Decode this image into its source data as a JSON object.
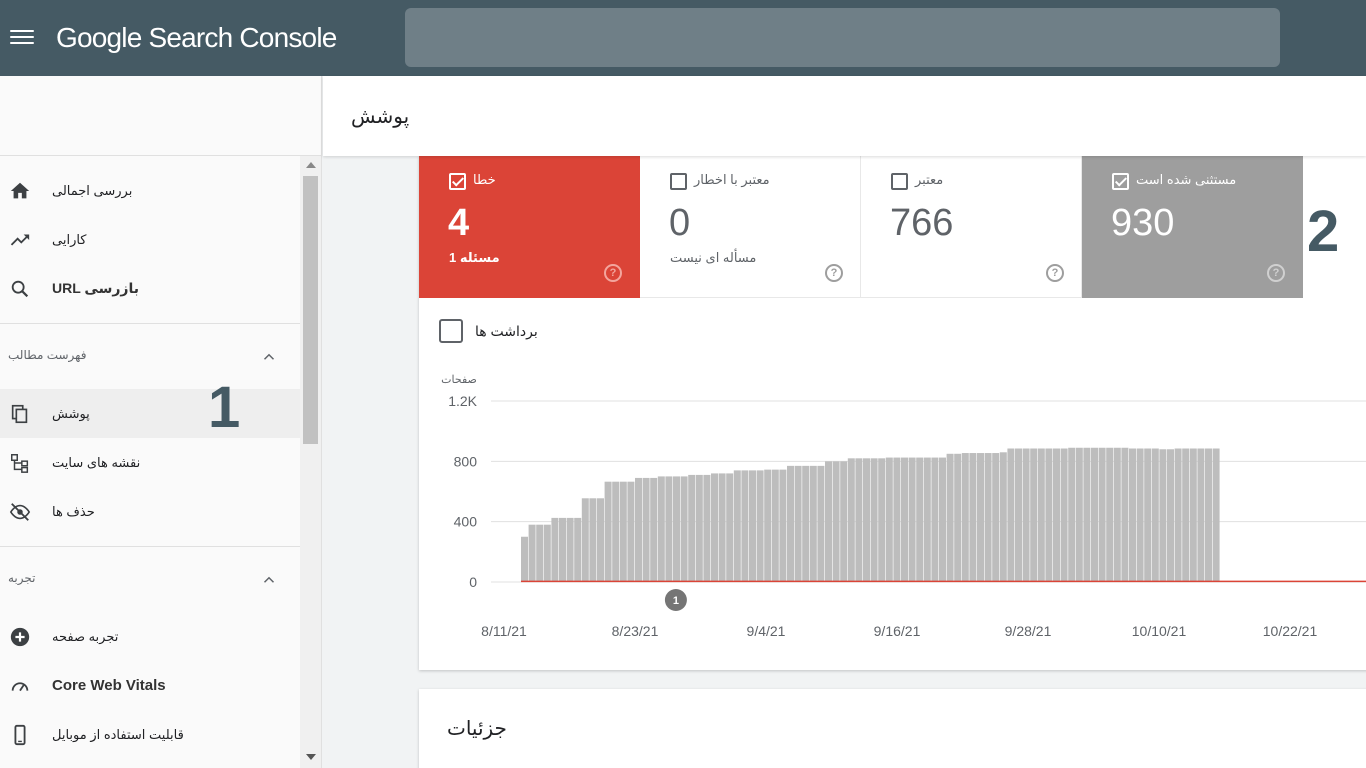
{
  "app": {
    "brand_google": "Google",
    "brand_product": "Search Console"
  },
  "page": {
    "title": "پوشش"
  },
  "sidebar": {
    "items_top": [
      {
        "label": "بررسی اجمالی",
        "icon": "home-icon"
      },
      {
        "label": "کارایی",
        "icon": "trending-up-icon"
      },
      {
        "label": "URL بازرسی",
        "icon": "search-icon"
      }
    ],
    "section_index": {
      "title": "فهرست مطالب"
    },
    "items_index": [
      {
        "label": "پوشش",
        "icon": "copy-pages-icon",
        "active": true
      },
      {
        "label": "نقشه های سایت",
        "icon": "sitemap-icon"
      },
      {
        "label": "حذف ها",
        "icon": "eye-off-icon"
      }
    ],
    "section_experience": {
      "title": "تجربه"
    },
    "items_experience": [
      {
        "label": "تجربه صفحه",
        "icon": "plus-circle-icon"
      },
      {
        "label": "Core Web Vitals",
        "icon": "speed-gauge-icon"
      },
      {
        "label": "قابلیت استفاده از موبایل",
        "icon": "smartphone-icon"
      }
    ]
  },
  "annotations": {
    "one": "1",
    "two": "2"
  },
  "tiles": [
    {
      "key": "error",
      "label": "خطا",
      "value": "4",
      "sub": "1 مسئله",
      "checked": true
    },
    {
      "key": "warning",
      "label": "معتبر با اخطار",
      "value": "0",
      "sub": "مسأله ای نیست",
      "checked": false
    },
    {
      "key": "valid",
      "label": "معتبر",
      "value": "766",
      "sub": "",
      "checked": false
    },
    {
      "key": "excluded",
      "label": "مستثنی شده است",
      "value": "930",
      "sub": "",
      "checked": true
    }
  ],
  "impressions_label": "برداشت ها",
  "colors": {
    "error": "#db4437",
    "excluded": "#9e9e9e",
    "topbar": "#455a64",
    "bar": "#bdbdbd"
  },
  "chart_data": {
    "type": "bar",
    "ylabel": "صفحات",
    "yticks": [
      "0",
      "400",
      "800",
      "1.2K"
    ],
    "ylim": [
      0,
      1200
    ],
    "xticks": [
      "8/11/21",
      "8/23/21",
      "9/4/21",
      "9/16/21",
      "9/28/21",
      "10/10/21",
      "10/22/21"
    ],
    "series": [
      {
        "name": "مستثنی شده است",
        "values": [
          300,
          380,
          380,
          380,
          425,
          425,
          425,
          425,
          555,
          555,
          555,
          665,
          665,
          665,
          665,
          690,
          690,
          690,
          700,
          700,
          700,
          700,
          710,
          710,
          710,
          720,
          720,
          720,
          740,
          740,
          740,
          740,
          745,
          745,
          745,
          770,
          770,
          770,
          770,
          770,
          800,
          800,
          800,
          820,
          820,
          820,
          820,
          820,
          825,
          825,
          825,
          825,
          825,
          825,
          825,
          825,
          850,
          850,
          855,
          855,
          855,
          855,
          855,
          860,
          885,
          885,
          885,
          885,
          885,
          885,
          885,
          885,
          890,
          890,
          890,
          890,
          890,
          890,
          890,
          890,
          885,
          885,
          885,
          885,
          880,
          880,
          885,
          885,
          885,
          885,
          885,
          885
        ]
      },
      {
        "name": "خطا",
        "values": [
          4,
          4,
          4,
          4,
          4,
          4,
          4,
          4,
          4,
          4,
          4,
          4,
          4,
          4,
          4,
          4,
          4,
          4,
          4,
          4,
          4,
          4,
          4,
          4,
          4,
          4,
          4,
          4,
          4,
          4,
          4,
          4,
          4,
          4,
          4,
          4,
          4,
          4,
          4,
          4,
          4,
          4,
          4,
          4,
          4,
          4,
          4,
          4,
          4,
          4,
          4,
          4,
          4,
          4,
          4,
          4,
          4,
          4,
          4,
          4,
          4,
          4,
          4,
          4,
          4,
          4,
          4,
          4,
          4,
          4,
          4,
          4,
          4,
          4,
          4,
          4,
          4,
          4,
          4,
          4,
          4,
          4,
          4,
          4,
          4,
          4,
          4,
          4,
          4,
          4,
          4,
          4
        ]
      }
    ],
    "annotation_marker": {
      "label": "1",
      "x_index": 14
    }
  },
  "details": {
    "title": "جزئیات"
  }
}
